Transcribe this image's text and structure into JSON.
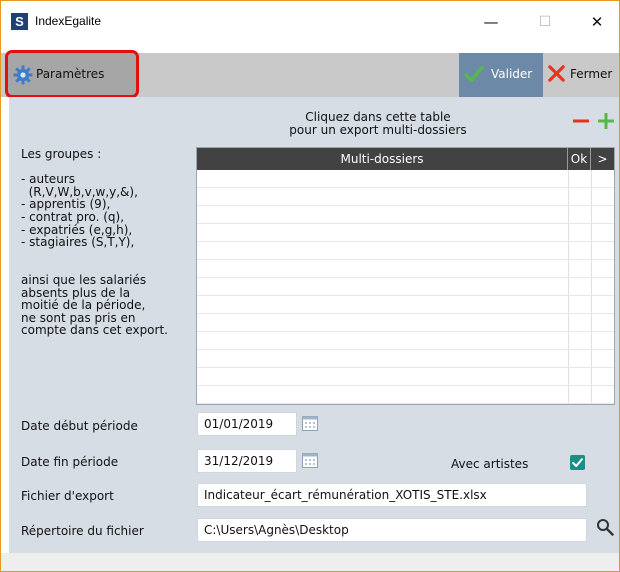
{
  "window": {
    "title": "IndexEgalite",
    "app_icon_letter": "S",
    "controls": [
      "—",
      "☐",
      "✕"
    ]
  },
  "toolbar": {
    "parametres_label": "Paramètres",
    "valider_label": "Valider",
    "fermer_label": "Fermer"
  },
  "table_area": {
    "instructions_line1": "Cliquez dans cette table",
    "instructions_line2": "pour un export multi-dossiers",
    "columns": [
      "Multi-dossiers",
      "Ok",
      ">"
    ]
  },
  "groups_info": "Les groupes :\n\n- auteurs\n  (R,V,W,b,v,w,y,&),\n- apprentis (9),\n- contrat pro. (q),\n- expatriés (e,g,h),\n- stagiaires (S,T,Y),\n\n\nainsi que les salariés\nabsents plus de la\nmoitié de la période,\nne sont pas pris en\ncompte dans cet export.",
  "form": {
    "date_debut_label": "Date début période",
    "date_debut_value": "01/01/2019",
    "date_fin_label": "Date fin période",
    "date_fin_value": "31/12/2019",
    "avec_artistes_label": "Avec artistes",
    "avec_artistes_checked": true,
    "fichier_label": "Fichier d'export",
    "fichier_value": "Indicateur_écart_rémunération_XOTIS_STE.xlsx",
    "repertoire_label": "Répertoire du fichier",
    "repertoire_value": "C:\\Users\\Agnès\\Desktop"
  },
  "colors": {
    "accent": "#6c8aa8",
    "header": "#424242",
    "panel": "#d6dde5",
    "highlight": "#e4100f",
    "check_green": "#55b948",
    "close_red": "#e8341c",
    "checkbox": "#1a8f86"
  },
  "icons": [
    "app-logo-icon",
    "gear-icon",
    "check-icon",
    "x-icon",
    "minus-icon",
    "plus-icon",
    "calendar-icon",
    "search-icon"
  ]
}
